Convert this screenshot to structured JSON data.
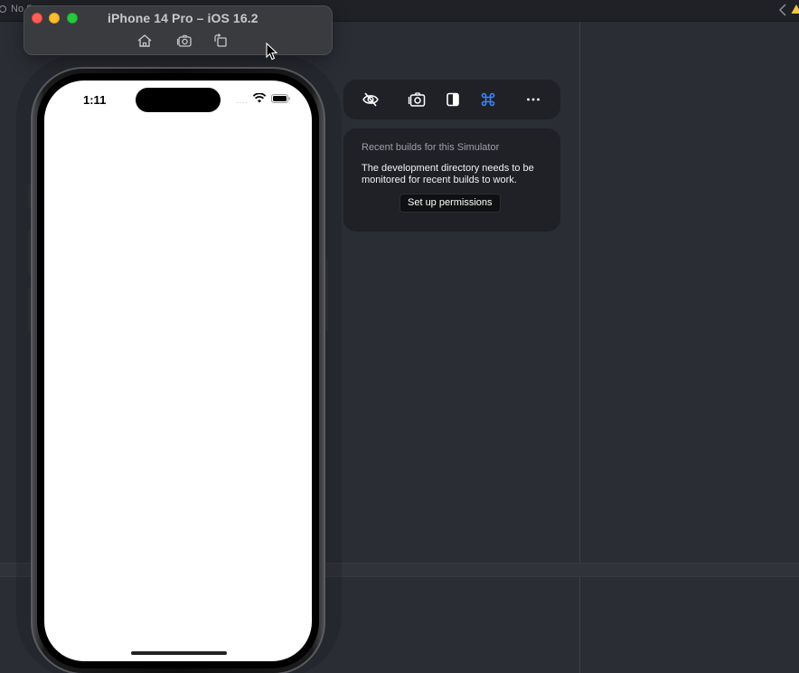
{
  "ide": {
    "topbar_text": "No S",
    "accent_warning": "#f5c542"
  },
  "simulator": {
    "title": "iPhone 14 Pro – iOS 16.2",
    "tools": [
      {
        "icon": "home-icon"
      },
      {
        "icon": "screenshot-icon"
      },
      {
        "icon": "rotate-icon"
      }
    ]
  },
  "phone": {
    "status_time": "1:11",
    "signal": "....",
    "screen_color": "#ffffff"
  },
  "panel": {
    "toolbar": [
      {
        "icon": "eye-slash-icon"
      },
      {
        "icon": "screenshot-icon"
      },
      {
        "icon": "sidebar-toggle-icon"
      },
      {
        "icon": "command-icon",
        "color": "#3b82f6"
      },
      {
        "icon": "more-icon"
      }
    ],
    "builds": {
      "title": "Recent builds for this Simulator",
      "message": "The development directory needs to be monitored for recent builds to work.",
      "button_label": "Set up permissions"
    }
  }
}
